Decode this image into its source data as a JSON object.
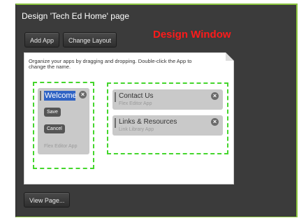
{
  "window": {
    "title": "Design 'Tech Ed Home' page"
  },
  "toolbar": {
    "add_app_label": "Add App",
    "change_layout_label": "Change Layout"
  },
  "annotation": {
    "label": "Design Window",
    "color": "#ff1a1a"
  },
  "canvas": {
    "instructions": "Organize your apps by dragging and dropping. Double-click the App to change the name."
  },
  "left_column": {
    "app": {
      "name_value": "Welcome",
      "save_label": "Save",
      "cancel_label": "Cancel",
      "type": "Flex Editor App",
      "close_icon": "close-icon"
    }
  },
  "right_column": {
    "apps": [
      {
        "name": "Contact Us",
        "type": "Flex Editor App",
        "close_icon": "close-icon"
      },
      {
        "name": "Links & Resources",
        "type": "Link Library App",
        "close_icon": "close-icon"
      }
    ]
  },
  "footer": {
    "view_page_label": "View Page..."
  },
  "colors": {
    "frame_bg": "#3b3b3b",
    "frame_border": "#8dc63f",
    "column_dash": "#44d62c",
    "selection": "#2f63c4"
  }
}
